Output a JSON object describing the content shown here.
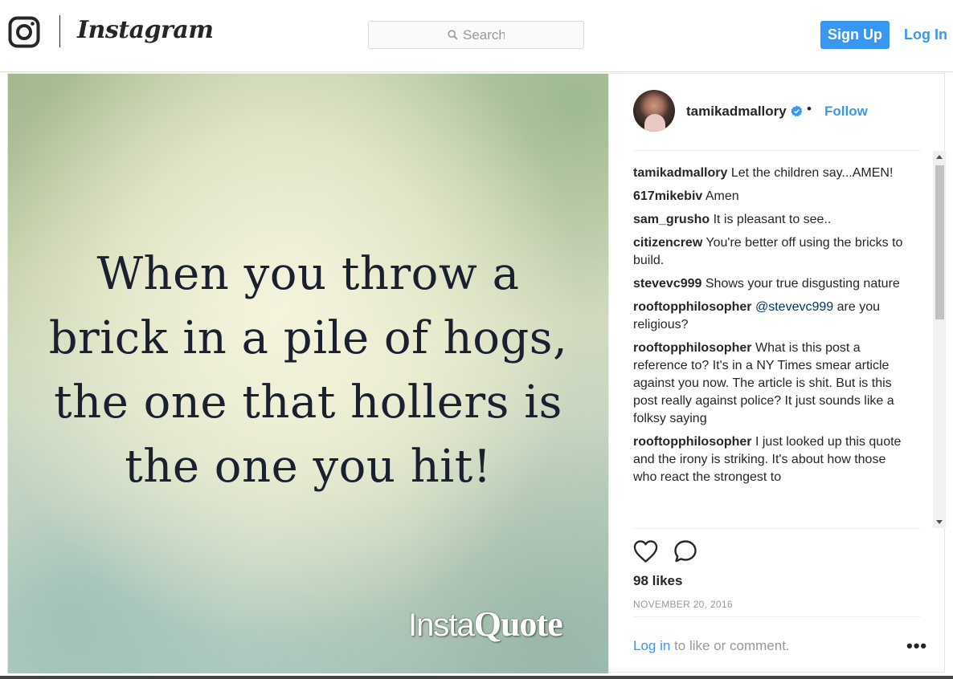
{
  "header": {
    "wordmark": "Instagram",
    "search_placeholder": "Search",
    "signup_label": "Sign Up",
    "login_label": "Log In"
  },
  "photo": {
    "quote_lines": [
      "When you throw a",
      "brick in a pile of hogs,",
      "the one that hollers is",
      "the one you hit!"
    ],
    "watermark_insta": "Insta",
    "watermark_quote": "Quote"
  },
  "post": {
    "username": "tamikadmallory",
    "dot": "•",
    "follow_label": "Follow",
    "comments": [
      {
        "user": "tamikadmallory",
        "text": "Let the children say...AMEN!"
      },
      {
        "user": "617mikebiv",
        "text": "Amen"
      },
      {
        "user": "sam_grusho",
        "text": "It is pleasant to see.."
      },
      {
        "user": "citizencrew",
        "text": "You're better off using the bricks to build."
      },
      {
        "user": "stevevc999",
        "text": "Shows your true disgusting nature"
      },
      {
        "user": "rooftopphilosopher",
        "mention": "@stevevc999",
        "text": "are you religious?"
      },
      {
        "user": "rooftopphilosopher",
        "text": "What is this post a reference to? It's in a NY Times smear article against you now. The article is shit. But is this post really against police? It just sounds like a folksy saying"
      },
      {
        "user": "rooftopphilosopher",
        "text": "I just looked up this quote and the irony is striking. It's about how those who react the strongest to"
      }
    ],
    "likes": "98 likes",
    "date": "NOVEMBER 20, 2016",
    "login_link": "Log in",
    "login_rest": " to like or comment.",
    "more": "•••"
  },
  "icons": {
    "logo": "instagram-camera-icon",
    "search": "search-icon",
    "verified": "verified-badge-icon",
    "like": "heart-icon",
    "comment": "comment-bubble-icon",
    "more": "more-options-icon"
  },
  "colors": {
    "accent": "#3897f0",
    "text": "#262626",
    "muted": "#999999",
    "border": "#dbdbdb"
  }
}
